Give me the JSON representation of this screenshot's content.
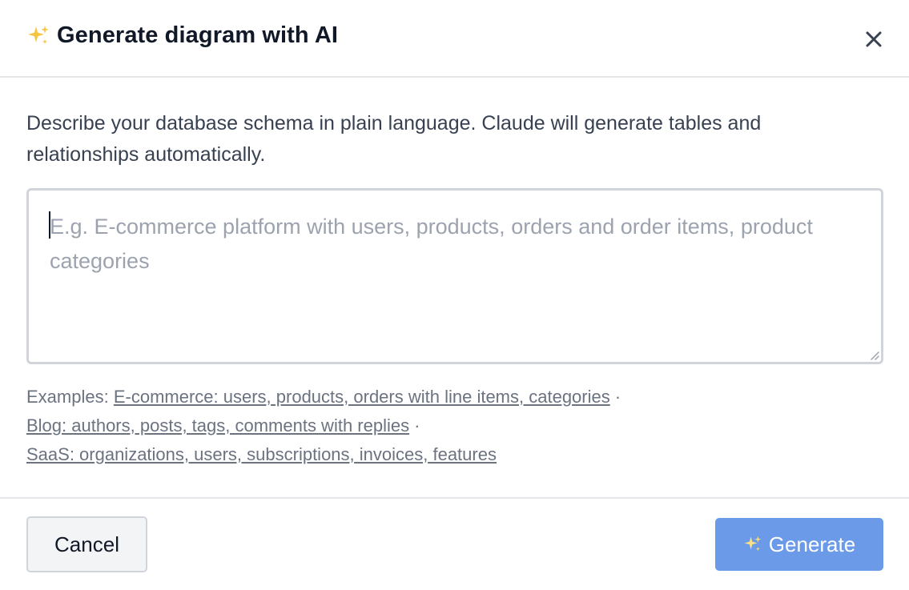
{
  "dialog": {
    "title": "Generate diagram with AI",
    "title_icon": "sparkles-icon",
    "close_icon": "close-icon"
  },
  "description": "Describe your database schema in plain language. Claude will generate tables and relationships automatically.",
  "prompt": {
    "value": "",
    "placeholder": "E.g. E-commerce platform with users, products, orders and order items, product categories"
  },
  "examples": {
    "label": "Examples:",
    "separator": "·",
    "items": [
      "E-commerce: users, products, orders with line items, categories",
      "Blog: authors, posts, tags, comments with replies",
      "SaaS: organizations, users, subscriptions, invoices, features"
    ]
  },
  "footer": {
    "cancel_label": "Cancel",
    "generate_label": "Generate",
    "generate_icon": "sparkles-icon"
  },
  "colors": {
    "primary_button": "#6b9ae8",
    "sparkle": "#f5c542",
    "border": "#d1d5db",
    "muted_text": "#6b7280"
  }
}
